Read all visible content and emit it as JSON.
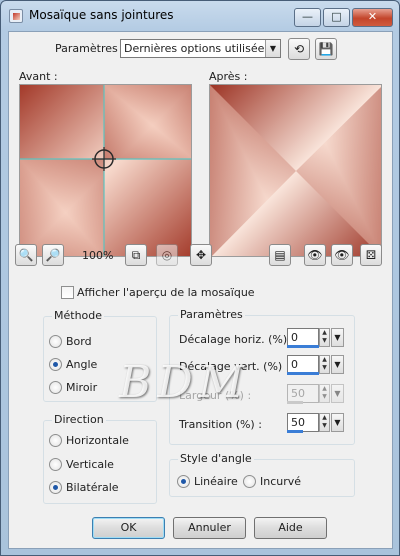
{
  "window": {
    "title": "Mosaïque sans jointures",
    "minimize_glyph": "—",
    "maximize_glyph": "□",
    "close_glyph": "✕"
  },
  "presets": {
    "label": "Paramètres :",
    "value": "Dernières options utilisées"
  },
  "preview": {
    "before_label": "Avant :",
    "after_label": "Après :",
    "zoom": "100%"
  },
  "show_preview_checkbox": "Afficher l'aperçu de la mosaïque",
  "method": {
    "title": "Méthode",
    "options": [
      "Bord",
      "Angle",
      "Miroir"
    ],
    "selected": "Angle"
  },
  "direction": {
    "title": "Direction",
    "options": [
      "Horizontale",
      "Verticale",
      "Bilatérale"
    ],
    "selected": "Bilatérale"
  },
  "params": {
    "title": "Paramètres",
    "h_offset_label": "Décalage horiz. (%) :",
    "h_offset_value": "0",
    "v_offset_label": "Décalage vert. (%) :",
    "v_offset_value": "0",
    "width_label": "Largeur (%) :",
    "width_value": "50",
    "transition_label": "Transition (%) :",
    "transition_value": "50"
  },
  "corner_style": {
    "title": "Style d'angle",
    "options": [
      "Linéaire",
      "Incurvé"
    ],
    "selected": "Linéaire"
  },
  "buttons": {
    "ok": "OK",
    "cancel": "Annuler",
    "help": "Aide"
  },
  "watermark": "BDM",
  "colors": {
    "preview_dark": "#a33a2a",
    "preview_light": "#f7d9cc",
    "accent": "#3a7dd6"
  }
}
